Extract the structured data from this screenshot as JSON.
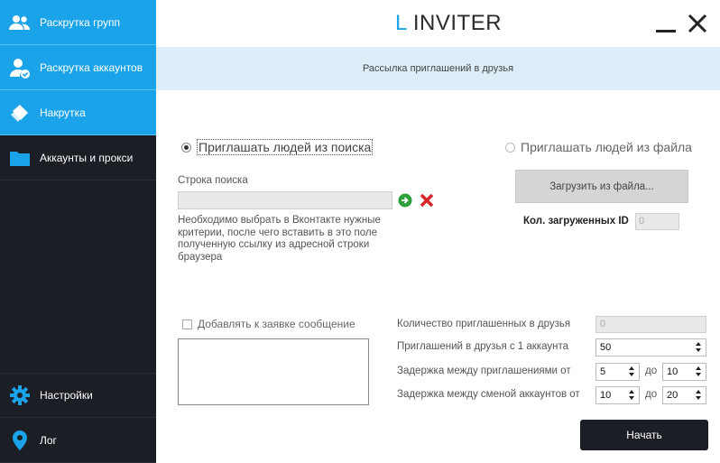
{
  "sidebar": {
    "items": [
      {
        "label": "Раскрутка групп",
        "icon": "users-icon"
      },
      {
        "label": "Раскрутка аккаунтов",
        "icon": "user-check-icon"
      },
      {
        "label": "Накрутка",
        "icon": "tag-icon"
      },
      {
        "label": "Аккаунты и прокси",
        "icon": "folder-icon"
      }
    ],
    "bottom": [
      {
        "label": "Настройки",
        "icon": "gear-icon"
      },
      {
        "label": "Лог",
        "icon": "location-pin-icon"
      }
    ]
  },
  "header": {
    "logo_letter": "L",
    "logo_text": "INVITER",
    "subtitle": "Рассылка приглашений в друзья"
  },
  "source": {
    "search_radio_label": "Приглашать людей из поиска",
    "file_radio_label": "Приглашать людей из файла",
    "selected": "search"
  },
  "search": {
    "label": "Строка поиска",
    "value": "",
    "hint": "Необходимо выбрать в Вконтакте нужные критерии, после чего вставить в это поле полученную ссылку из адресной строки браузера"
  },
  "file": {
    "load_button": "Загрузить из файла...",
    "loaded_label": "Кол. загруженных ID",
    "loaded_value": "0"
  },
  "message": {
    "checkbox_label": "Добавлять к заявке сообщение",
    "checked": false,
    "text": ""
  },
  "settings": {
    "invited_label": "Количество приглашенных в друзья",
    "invited_value": "0",
    "per_account_label": "Приглашений в друзья с 1 аккаунта",
    "per_account_value": "50",
    "delay_invites_label": "Задержка между приглашениями от",
    "delay_invites_from": "5",
    "delay_invites_to": "10",
    "delay_accounts_label": "Задержка между сменой аккаунтов от",
    "delay_accounts_from": "10",
    "delay_accounts_to": "20",
    "to_label": "до"
  },
  "actions": {
    "start_label": "Начать"
  },
  "colors": {
    "accent": "#1aa3e8",
    "sidebar_bg": "#1c1e25",
    "subbar_bg": "#ddeef8",
    "ok_green": "#2e9e3a",
    "cancel_red": "#d8252a"
  }
}
